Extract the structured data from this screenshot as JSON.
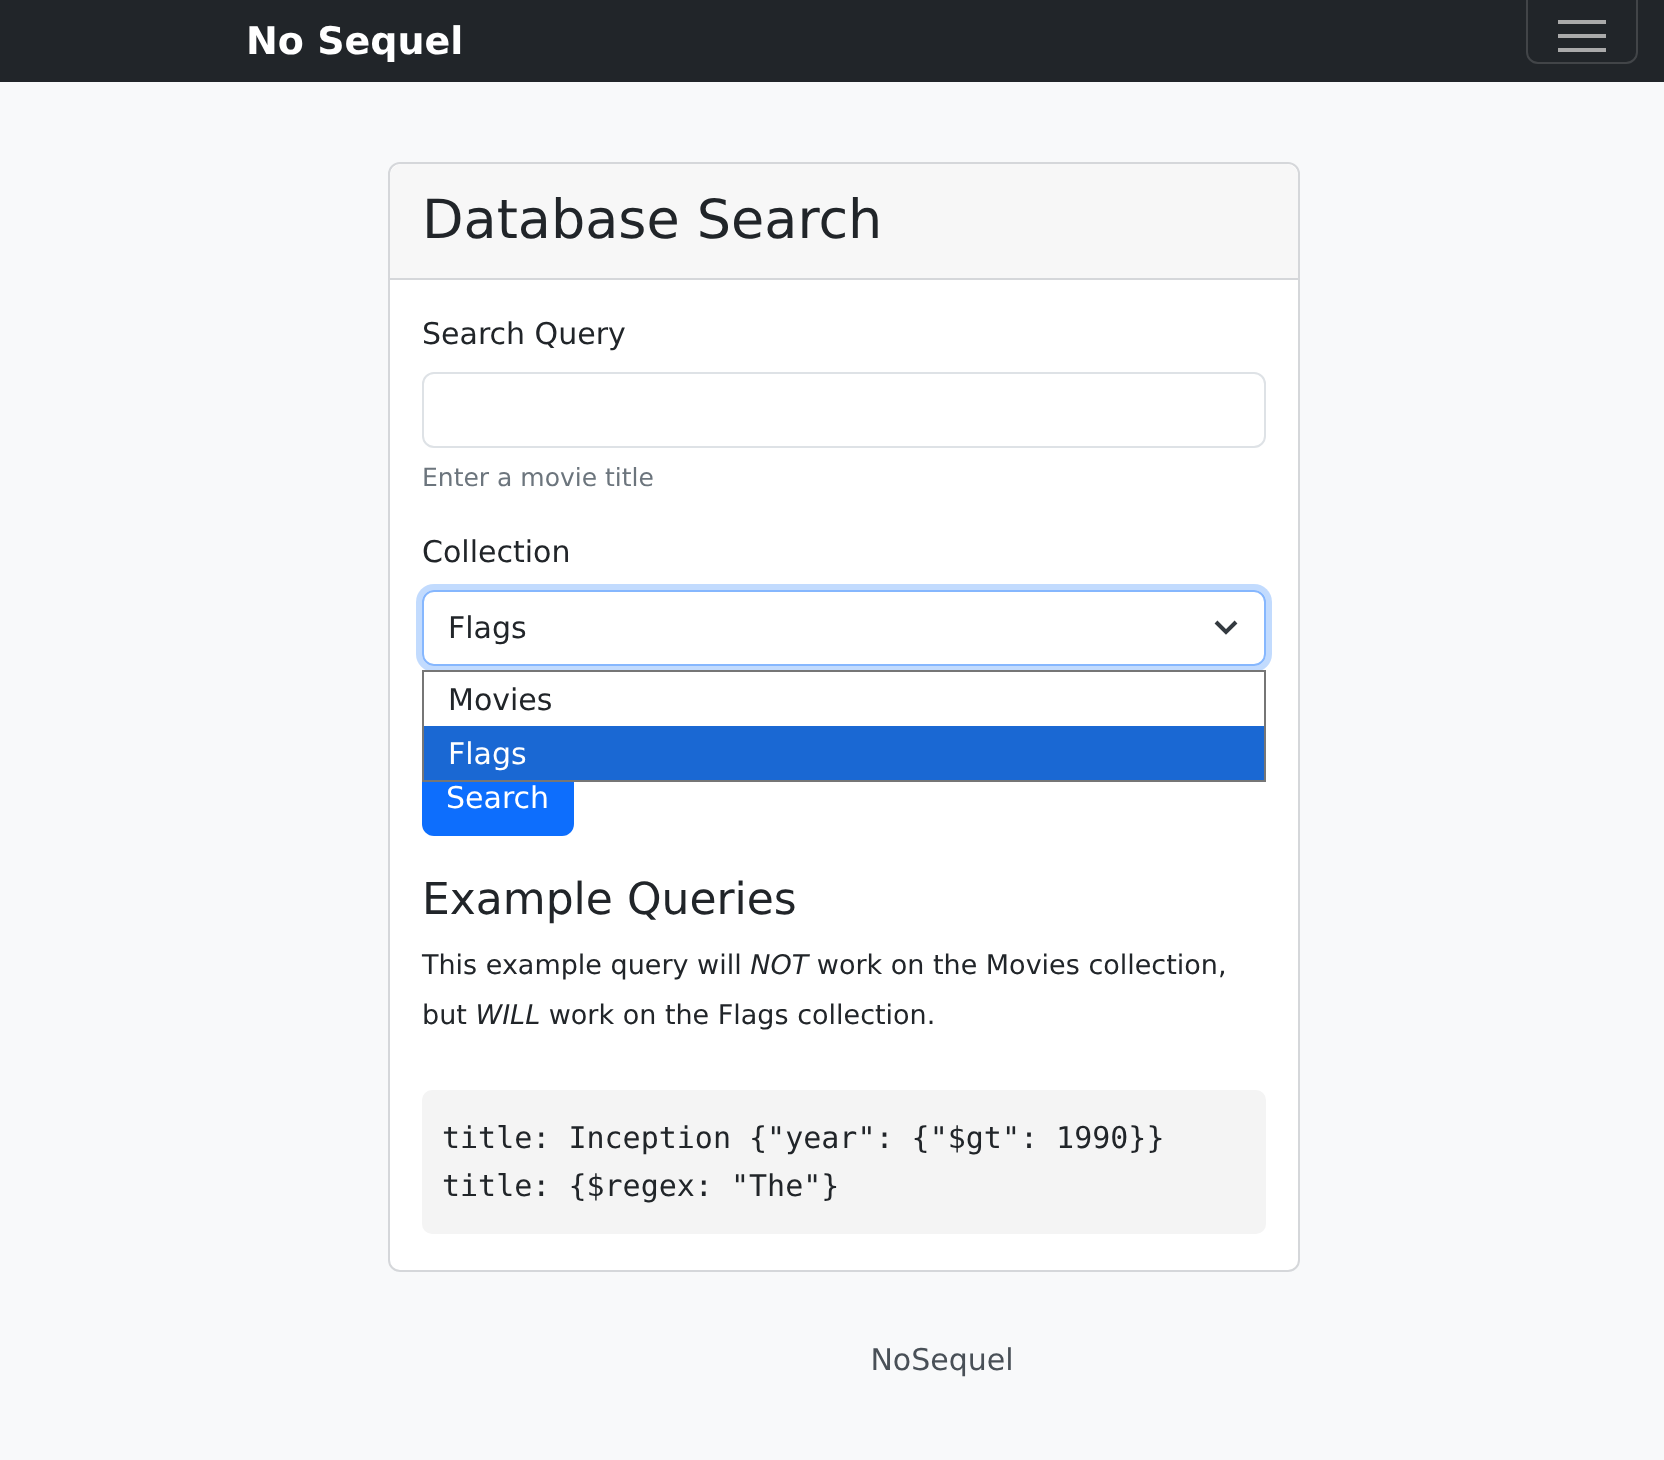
{
  "navbar": {
    "brand": "No Sequel"
  },
  "card": {
    "title": "Database Search",
    "query": {
      "label": "Search Query",
      "help": "Enter a movie title"
    },
    "collection": {
      "label": "Collection",
      "value": "Flags",
      "expanded": true,
      "options": [
        {
          "label": "Movies",
          "selected": false
        },
        {
          "label": "Flags",
          "selected": true
        }
      ]
    },
    "search_button": "Search",
    "examples": {
      "heading": "Example Queries",
      "text": "This example query will *NOT* work on the Movies collection, but *WILL* work on the Flags collection.",
      "code": [
        "title: Inception {\"year\": {\"$gt\": 1990}}",
        "title: {$regex: \"The\"}"
      ]
    }
  },
  "footer": "NoSequel"
}
